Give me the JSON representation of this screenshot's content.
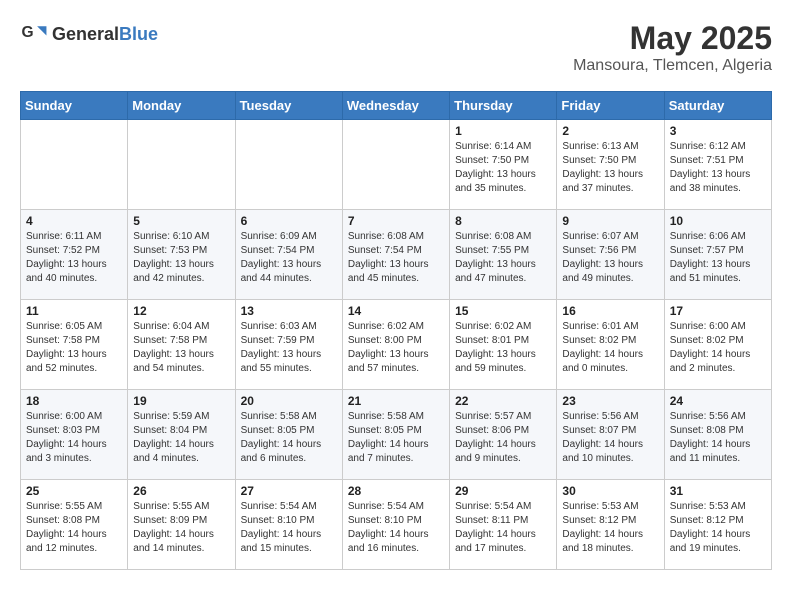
{
  "header": {
    "logo_general": "General",
    "logo_blue": "Blue",
    "month_year": "May 2025",
    "location": "Mansoura, Tlemcen, Algeria"
  },
  "days_of_week": [
    "Sunday",
    "Monday",
    "Tuesday",
    "Wednesday",
    "Thursday",
    "Friday",
    "Saturday"
  ],
  "weeks": [
    [
      {
        "day": "",
        "sunrise": "",
        "sunset": "",
        "daylight": ""
      },
      {
        "day": "",
        "sunrise": "",
        "sunset": "",
        "daylight": ""
      },
      {
        "day": "",
        "sunrise": "",
        "sunset": "",
        "daylight": ""
      },
      {
        "day": "",
        "sunrise": "",
        "sunset": "",
        "daylight": ""
      },
      {
        "day": "1",
        "sunrise": "6:14 AM",
        "sunset": "7:50 PM",
        "daylight": "13 hours and 35 minutes."
      },
      {
        "day": "2",
        "sunrise": "6:13 AM",
        "sunset": "7:50 PM",
        "daylight": "13 hours and 37 minutes."
      },
      {
        "day": "3",
        "sunrise": "6:12 AM",
        "sunset": "7:51 PM",
        "daylight": "13 hours and 38 minutes."
      }
    ],
    [
      {
        "day": "4",
        "sunrise": "6:11 AM",
        "sunset": "7:52 PM",
        "daylight": "13 hours and 40 minutes."
      },
      {
        "day": "5",
        "sunrise": "6:10 AM",
        "sunset": "7:53 PM",
        "daylight": "13 hours and 42 minutes."
      },
      {
        "day": "6",
        "sunrise": "6:09 AM",
        "sunset": "7:54 PM",
        "daylight": "13 hours and 44 minutes."
      },
      {
        "day": "7",
        "sunrise": "6:08 AM",
        "sunset": "7:54 PM",
        "daylight": "13 hours and 45 minutes."
      },
      {
        "day": "8",
        "sunrise": "6:08 AM",
        "sunset": "7:55 PM",
        "daylight": "13 hours and 47 minutes."
      },
      {
        "day": "9",
        "sunrise": "6:07 AM",
        "sunset": "7:56 PM",
        "daylight": "13 hours and 49 minutes."
      },
      {
        "day": "10",
        "sunrise": "6:06 AM",
        "sunset": "7:57 PM",
        "daylight": "13 hours and 51 minutes."
      }
    ],
    [
      {
        "day": "11",
        "sunrise": "6:05 AM",
        "sunset": "7:58 PM",
        "daylight": "13 hours and 52 minutes."
      },
      {
        "day": "12",
        "sunrise": "6:04 AM",
        "sunset": "7:58 PM",
        "daylight": "13 hours and 54 minutes."
      },
      {
        "day": "13",
        "sunrise": "6:03 AM",
        "sunset": "7:59 PM",
        "daylight": "13 hours and 55 minutes."
      },
      {
        "day": "14",
        "sunrise": "6:02 AM",
        "sunset": "8:00 PM",
        "daylight": "13 hours and 57 minutes."
      },
      {
        "day": "15",
        "sunrise": "6:02 AM",
        "sunset": "8:01 PM",
        "daylight": "13 hours and 59 minutes."
      },
      {
        "day": "16",
        "sunrise": "6:01 AM",
        "sunset": "8:02 PM",
        "daylight": "14 hours and 0 minutes."
      },
      {
        "day": "17",
        "sunrise": "6:00 AM",
        "sunset": "8:02 PM",
        "daylight": "14 hours and 2 minutes."
      }
    ],
    [
      {
        "day": "18",
        "sunrise": "6:00 AM",
        "sunset": "8:03 PM",
        "daylight": "14 hours and 3 minutes."
      },
      {
        "day": "19",
        "sunrise": "5:59 AM",
        "sunset": "8:04 PM",
        "daylight": "14 hours and 4 minutes."
      },
      {
        "day": "20",
        "sunrise": "5:58 AM",
        "sunset": "8:05 PM",
        "daylight": "14 hours and 6 minutes."
      },
      {
        "day": "21",
        "sunrise": "5:58 AM",
        "sunset": "8:05 PM",
        "daylight": "14 hours and 7 minutes."
      },
      {
        "day": "22",
        "sunrise": "5:57 AM",
        "sunset": "8:06 PM",
        "daylight": "14 hours and 9 minutes."
      },
      {
        "day": "23",
        "sunrise": "5:56 AM",
        "sunset": "8:07 PM",
        "daylight": "14 hours and 10 minutes."
      },
      {
        "day": "24",
        "sunrise": "5:56 AM",
        "sunset": "8:08 PM",
        "daylight": "14 hours and 11 minutes."
      }
    ],
    [
      {
        "day": "25",
        "sunrise": "5:55 AM",
        "sunset": "8:08 PM",
        "daylight": "14 hours and 12 minutes."
      },
      {
        "day": "26",
        "sunrise": "5:55 AM",
        "sunset": "8:09 PM",
        "daylight": "14 hours and 14 minutes."
      },
      {
        "day": "27",
        "sunrise": "5:54 AM",
        "sunset": "8:10 PM",
        "daylight": "14 hours and 15 minutes."
      },
      {
        "day": "28",
        "sunrise": "5:54 AM",
        "sunset": "8:10 PM",
        "daylight": "14 hours and 16 minutes."
      },
      {
        "day": "29",
        "sunrise": "5:54 AM",
        "sunset": "8:11 PM",
        "daylight": "14 hours and 17 minutes."
      },
      {
        "day": "30",
        "sunrise": "5:53 AM",
        "sunset": "8:12 PM",
        "daylight": "14 hours and 18 minutes."
      },
      {
        "day": "31",
        "sunrise": "5:53 AM",
        "sunset": "8:12 PM",
        "daylight": "14 hours and 19 minutes."
      }
    ]
  ]
}
